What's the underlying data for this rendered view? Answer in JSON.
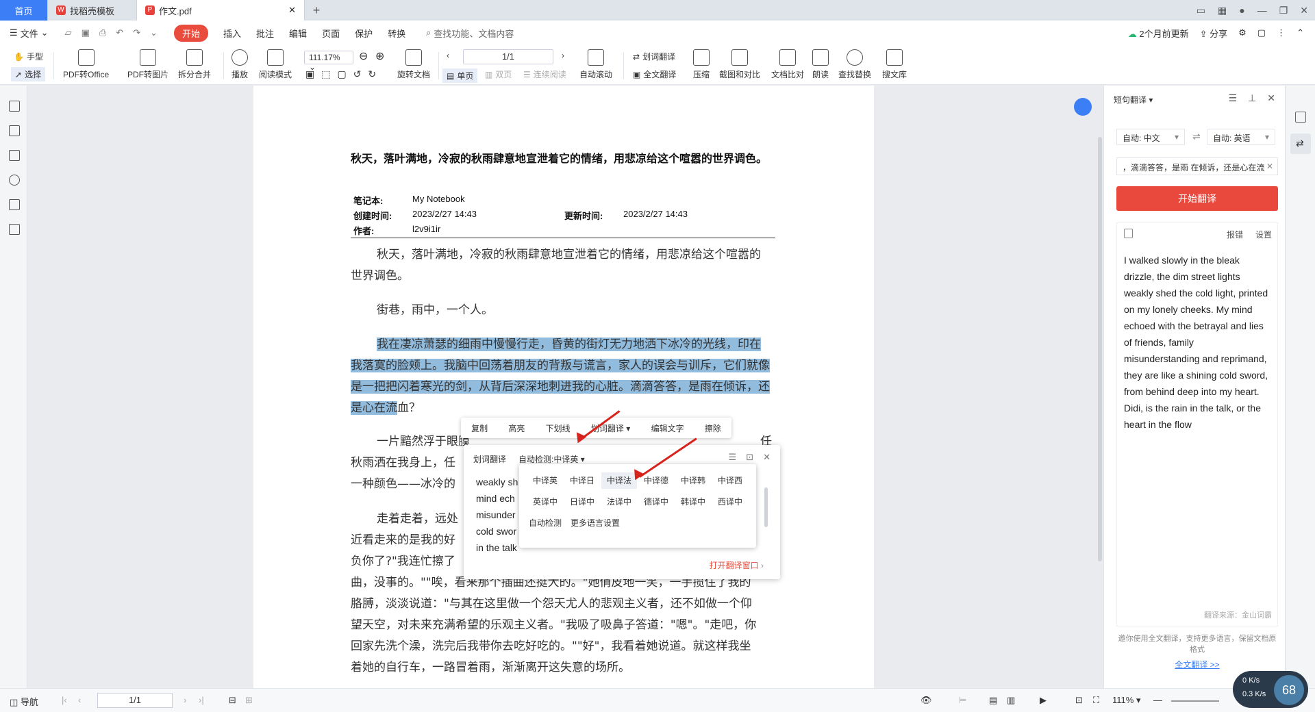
{
  "tabs": {
    "home": "首页",
    "template": "找稻壳模板",
    "doc": "作文.pdf",
    "add": "+"
  },
  "menu": {
    "file": "文件",
    "start": "开始",
    "insert": "插入",
    "annotate": "批注",
    "edit": "编辑",
    "page": "页面",
    "protect": "保护",
    "convert": "转换",
    "search": "查找功能、文档内容",
    "saved": "2个月前更新",
    "share": "分享"
  },
  "toolbar": {
    "hand": "手型",
    "select": "选择",
    "pdf_to_office": "PDF转Office",
    "pdf_to_image": "PDF转图片",
    "split_merge": "拆分合并",
    "play": "播放",
    "read_mode": "阅读模式",
    "zoom": "111.17%",
    "rotate": "旋转文档",
    "page": "1/1",
    "single": "单页",
    "double": "双页",
    "continuous": "连续阅读",
    "auto_scroll": "自动滚动",
    "word_translate": "划词翻译",
    "full_translate": "全文翻译",
    "compress": "压缩",
    "screenshot": "截图和对比",
    "compare": "文档比对",
    "read_aloud": "朗读",
    "find_replace": "查找替换",
    "library": "搜文库"
  },
  "doc": {
    "title": "秋天，落叶满地，冷寂的秋雨肆意地宣泄着它的情绪，用悲凉给这个喧嚣的世界调色。",
    "notebook_label": "笔记本:",
    "notebook": "My Notebook",
    "created_label": "创建时间:",
    "created": "2023/2/27 14:43",
    "updated_label": "更新时间:",
    "updated": "2023/2/27 14:43",
    "author_label": "作者:",
    "author": "l2v9i1ir",
    "p1": "秋天，落叶满地，冷寂的秋雨肆意地宣泄着它的情绪，用悲凉给这个喧嚣的世界调色。",
    "p2": "街巷，雨中，一个人。",
    "p3_highlight": "我在凄凉萧瑟的细雨中慢慢行走，昏黄的街灯无力地洒下冰冷的光线，印在我落寞的脸颊上。我脑中回荡着朋友的背叛与谎言，家人的误会与训斥，它们就像是一把把闪着寒光的剑，从背后深深地刺进我的心脏。滴滴答答，是雨在倾诉，还是心在流",
    "p3_rest": "血？",
    "p4_a": "一片黯然浮于眼膜",
    "p4_b": "秋雨洒在我身上，任",
    "p4_c": "一种颜色——冰冷的",
    "p4_tail": "任",
    "p5_a": "走着走着，远处",
    "p5_b": "近看走来的是我的好",
    "p5_c": "负你了?\"我连忙擦了",
    "p5_d": "曲，没事的。\"\"唉，看来那个插曲还挺大的。\"她俏皮地一笑，一手揽住了我的",
    "p5_e": "胳膊，淡淡说道：\"与其在这里做一个怨天尤人的悲观主义者，还不如做一个仰",
    "p5_f": "望天空，对未来充满希望的乐观主义者。\"我吸了吸鼻子答道：\"嗯\"。\"走吧，你",
    "p5_g": "回家先洗个澡，洗完后我带你去吃好吃的。\"\"好\"，我看着她说道。就这样我坐",
    "p5_h": "着她的自行车，一路冒着雨，渐渐离开这失意的场所。"
  },
  "selection_menu": [
    "复制",
    "高亮",
    "下划线",
    "划词翻译",
    "编辑文字",
    "擦除"
  ],
  "translate_popup": {
    "title": "划词翻译",
    "mode": "自动检测:中译英",
    "text": [
      "weakly sh",
      "mind ech",
      "misunder",
      "cold swor",
      "in the talk"
    ],
    "open": "打开翻译窗口"
  },
  "lang_menu": [
    [
      "中译英",
      "中译日",
      "中译法",
      "中译德",
      "中译韩",
      "中译西"
    ],
    [
      "英译中",
      "日译中",
      "法译中",
      "德译中",
      "韩译中",
      "西译中"
    ],
    [
      "自动检测",
      "更多语言设置"
    ]
  ],
  "right_panel": {
    "title": "短句翻译",
    "from": "自动: 中文",
    "to": "自动: 英语",
    "input": "，滴滴答答，是雨 在倾诉，还是心在流",
    "button": "开始翻译",
    "report": "报错",
    "settings": "设置",
    "result": "I walked slowly in the bleak drizzle, the dim street lights weakly shed the cold light, printed on my lonely cheeks. My mind echoed with the betrayal and lies of friends, family misunderstanding and reprimand, they are like a shining cold sword, from behind deep into my heart. Didi, is the rain in the talk, or the heart in the flow",
    "source": "翻译来源：金山词霸",
    "promo": "邀你使用全文翻译，支持更多语言，保留文档原格式",
    "promo_link": "全文翻译 >>"
  },
  "statusbar": {
    "nav": "导航",
    "page": "1/1",
    "zoom": "111%"
  },
  "speed": {
    "up": "0",
    "down": "0.3",
    "unit": "K/s",
    "percent": "68"
  }
}
